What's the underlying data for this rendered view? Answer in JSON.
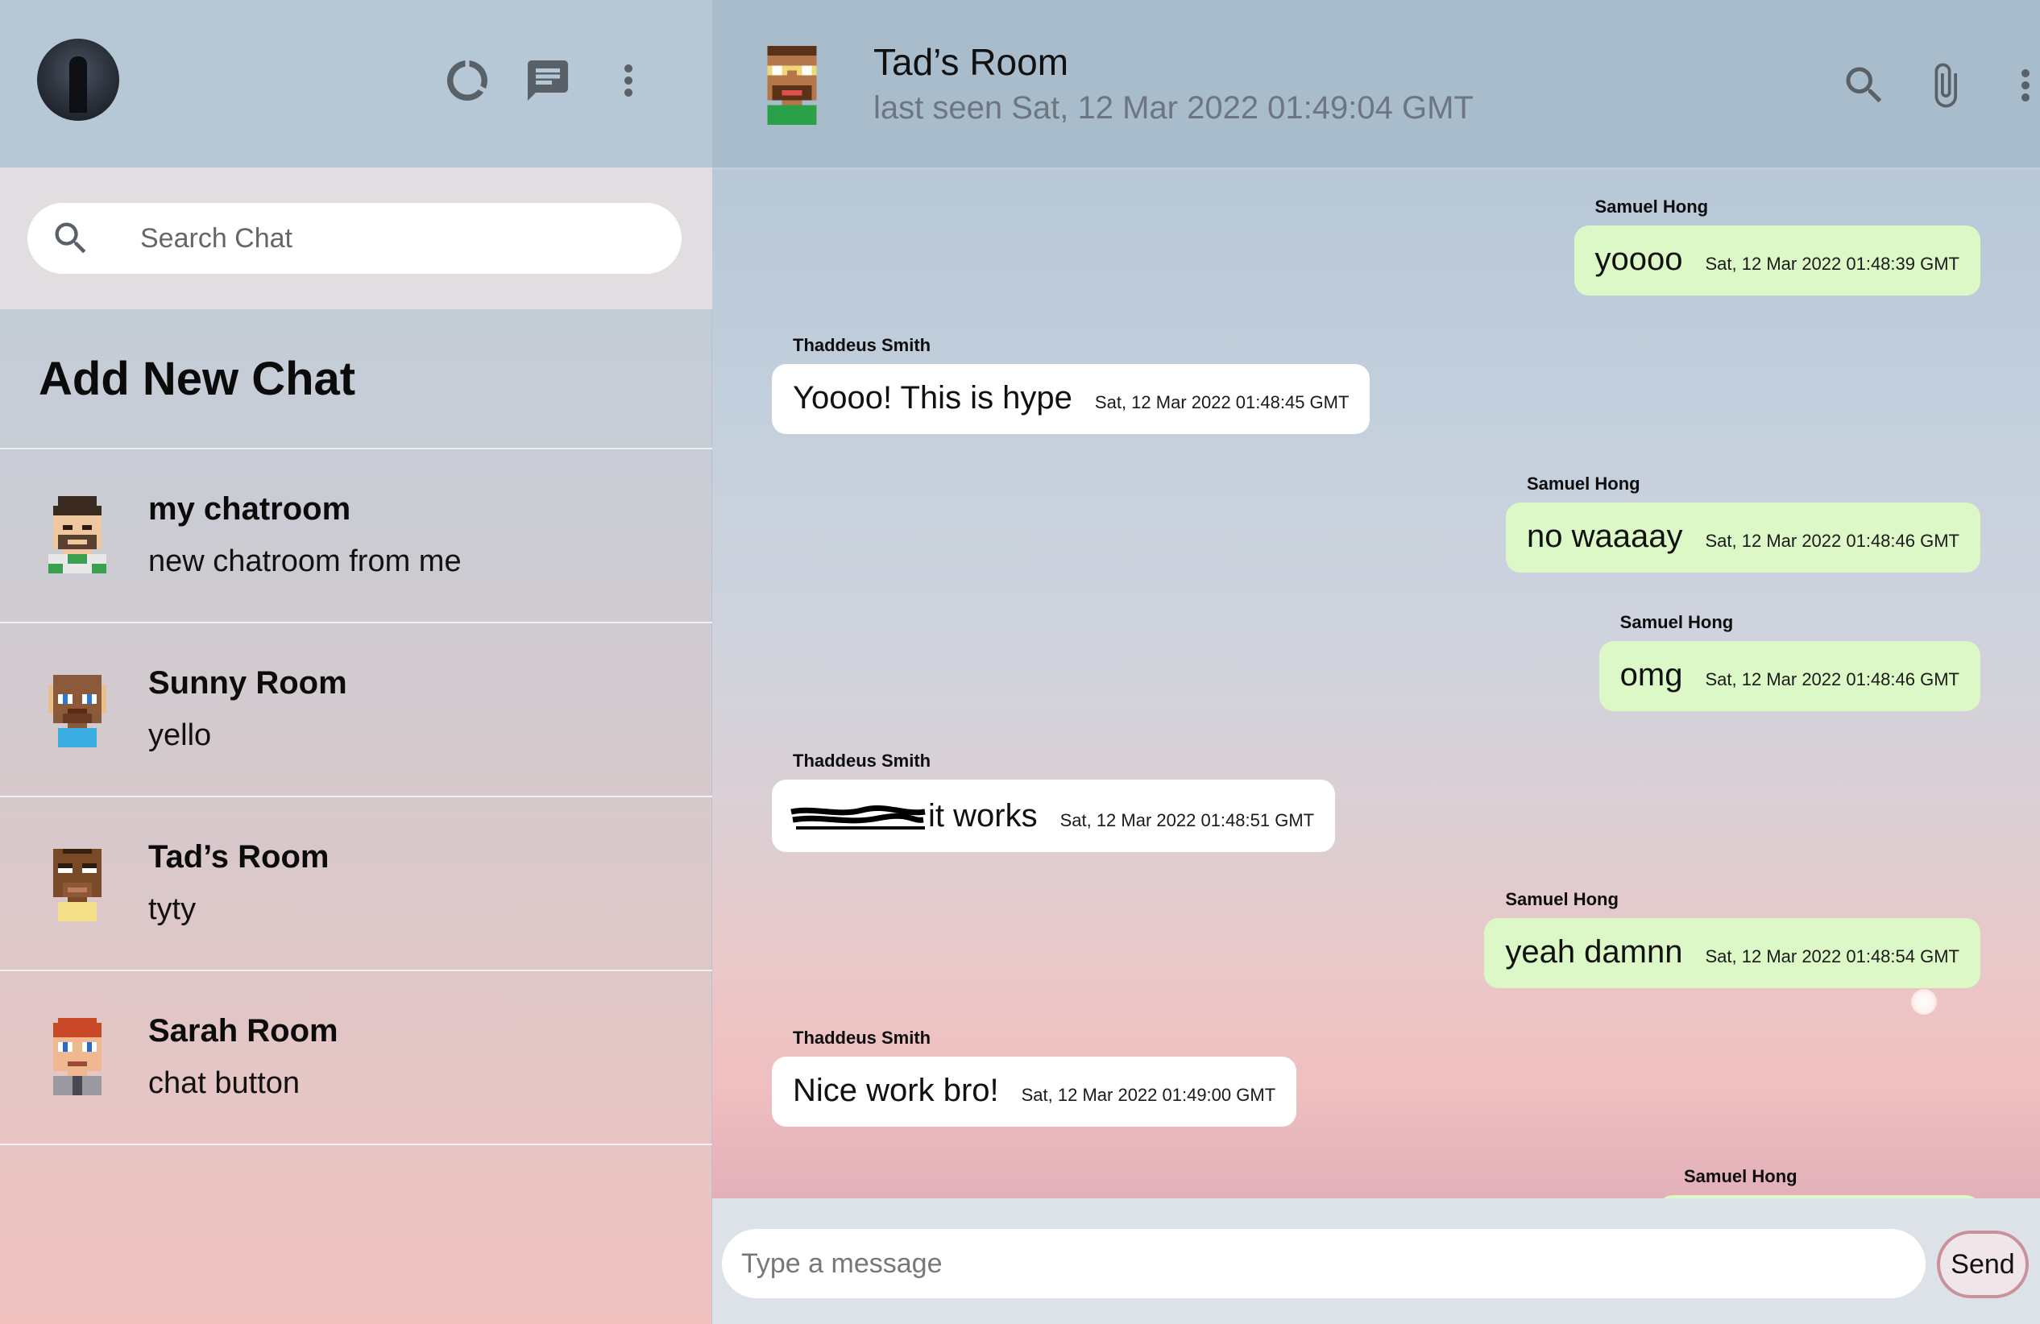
{
  "sidebar": {
    "avatar_icon": "user-avatar",
    "header_icons": [
      "status-icon",
      "new-chat-icon",
      "more-vert-icon"
    ],
    "search": {
      "placeholder": "Search Chat"
    },
    "add_new_chat_label": "Add New Chat",
    "chats": [
      {
        "name": "my chatroom",
        "last_message": "new chatroom from me"
      },
      {
        "name": "Sunny Room",
        "last_message": "yello"
      },
      {
        "name": "Tad’s Room",
        "last_message": "tyty"
      },
      {
        "name": "Sarah Room",
        "last_message": "chat button"
      }
    ]
  },
  "chat": {
    "title": "Tad’s Room",
    "subtitle": "last seen Sat, 12 Mar 2022 01:49:04 GMT",
    "header_icons": [
      "search-icon",
      "attach-icon",
      "more-vert-icon"
    ],
    "messages": [
      {
        "sender": "Samuel Hong",
        "text": "yoooo",
        "time": "Sat, 12 Mar 2022 01:48:39 GMT",
        "mine": true
      },
      {
        "sender": "Thaddeus Smith",
        "text": "Yoooo! This is hype",
        "time": "Sat, 12 Mar 2022 01:48:45 GMT",
        "mine": false
      },
      {
        "sender": "Samuel Hong",
        "text": "no waaaay",
        "time": "Sat, 12 Mar 2022 01:48:46 GMT",
        "mine": true
      },
      {
        "sender": "Samuel Hong",
        "text": "omg",
        "time": "Sat, 12 Mar 2022 01:48:46 GMT",
        "mine": true
      },
      {
        "sender": "Thaddeus Smith",
        "text": "it works",
        "time": "Sat, 12 Mar 2022 01:48:51 GMT",
        "mine": false
      },
      {
        "sender": "Samuel Hong",
        "text": "yeah damnn",
        "time": "Sat, 12 Mar 2022 01:48:54 GMT",
        "mine": true
      },
      {
        "sender": "Thaddeus Smith",
        "text": "Nice work bro!",
        "time": "Sat, 12 Mar 2022 01:49:00 GMT",
        "mine": false
      },
      {
        "sender": "Samuel Hong",
        "text": "",
        "time": "",
        "mine": true
      }
    ],
    "composer": {
      "placeholder": "Type a message",
      "send_label": "Send"
    }
  },
  "colors": {
    "sidebar_header": "#b6c8d6",
    "chat_header": "#a9bccb",
    "own_bubble": "#dcf8c6",
    "other_bubble": "#ffffff",
    "send_border": "#c9919a"
  }
}
